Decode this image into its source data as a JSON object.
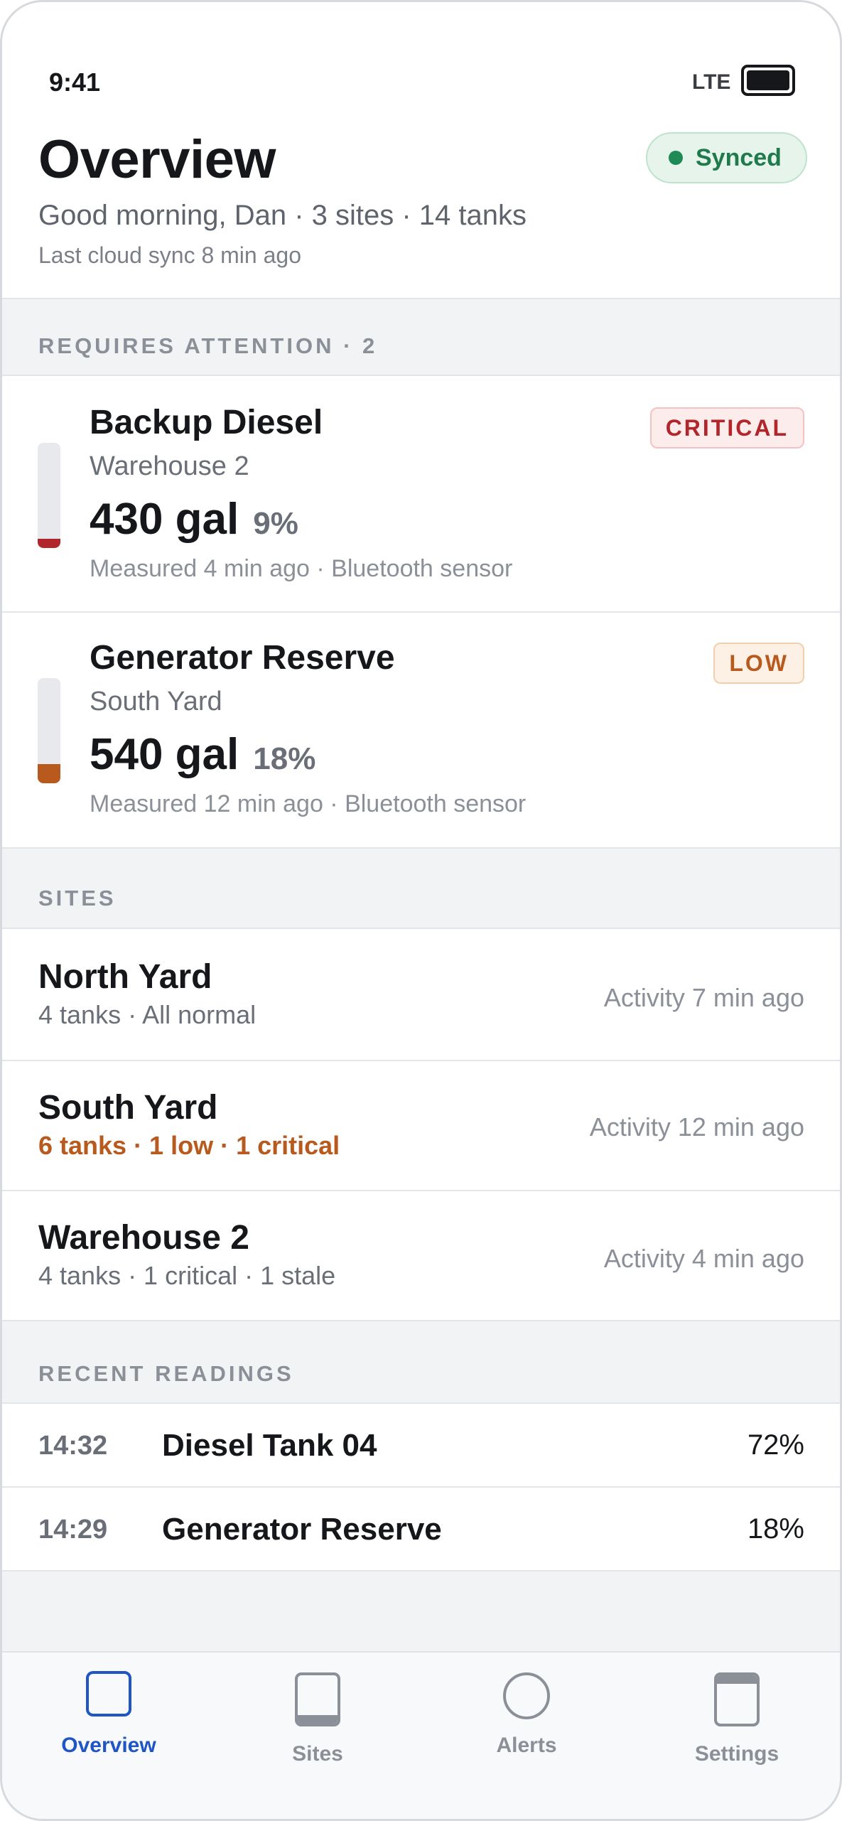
{
  "status_bar": {
    "time": "9:41",
    "network": "LTE"
  },
  "header": {
    "title": "Overview",
    "sync_badge": "Synced",
    "subtitle": "Good morning, Dan · 3 sites · 14 tanks",
    "last_sync": "Last cloud sync 8 min ago"
  },
  "attention": {
    "heading": "REQUIRES ATTENTION · 2",
    "items": [
      {
        "name": "Backup Diesel",
        "site": "Warehouse 2",
        "amount": "430 gal",
        "percent": "9%",
        "level": 0.09,
        "meta": "Measured 4 min ago · Bluetooth sensor",
        "badge": "CRITICAL",
        "color": "#b0262b"
      },
      {
        "name": "Generator Reserve",
        "site": "South Yard",
        "amount": "540 gal",
        "percent": "18%",
        "level": 0.18,
        "meta": "Measured 12 min ago · Bluetooth sensor",
        "badge": "LOW",
        "color": "#b8591d"
      }
    ]
  },
  "sites": {
    "heading": "SITES",
    "items": [
      {
        "name": "North Yard",
        "summary": "4 tanks · All normal",
        "activity": "Activity 7 min ago"
      },
      {
        "name": "South Yard",
        "summary": "6 tanks · 1 low · 1 critical",
        "activity": "Activity 12 min ago"
      },
      {
        "name": "Warehouse 2",
        "summary": "4 tanks · 1 critical · 1 stale",
        "activity": "Activity 4 min ago"
      }
    ]
  },
  "readings": {
    "heading": "RECENT READINGS",
    "items": [
      {
        "time": "14:32",
        "name": "Diesel Tank 04",
        "value": "72%"
      },
      {
        "time": "14:29",
        "name": "Generator Reserve",
        "value": "18%"
      }
    ]
  },
  "tabs": {
    "overview": "Overview",
    "sites": "Sites",
    "alerts": "Alerts",
    "settings": "Settings"
  },
  "colors": {
    "accent": "#1f56c4",
    "synced": "#1f7a4c",
    "critical": "#b0262b",
    "low": "#b8591d"
  }
}
